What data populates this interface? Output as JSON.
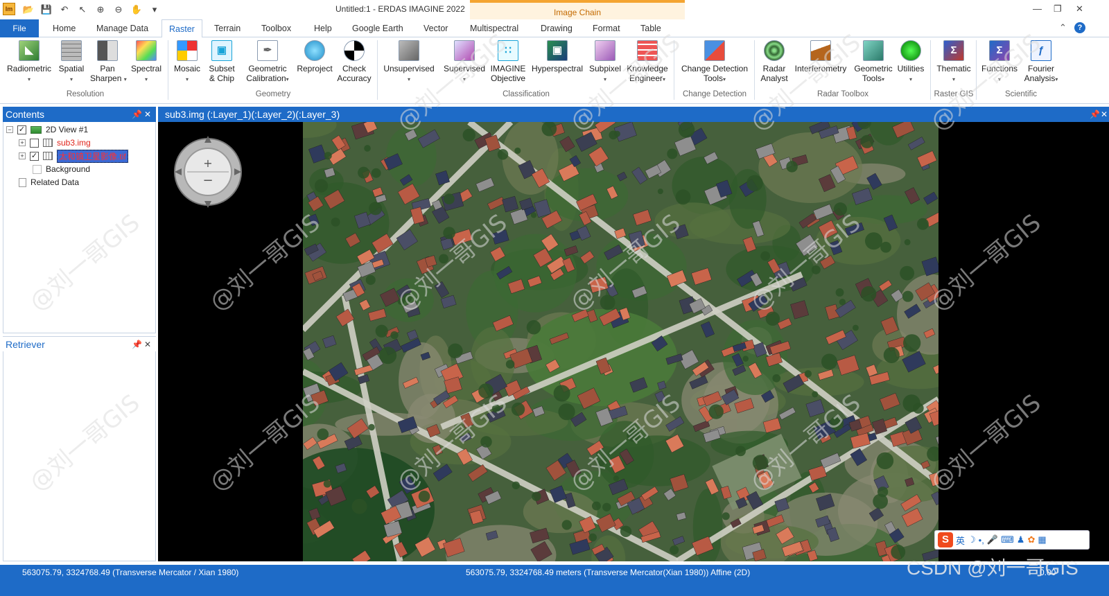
{
  "window": {
    "title": "Untitled:1 - ERDAS IMAGINE 2022",
    "contextual_tab": "Image Chain",
    "app_icon": "Im"
  },
  "quick_access": [
    "app-icon",
    "open-icon",
    "save-icon",
    "undo-icon",
    "select-icon",
    "zoom-in-icon",
    "zoom-out-icon",
    "pan-icon",
    "customize-icon"
  ],
  "tabs": {
    "file": "File",
    "items": [
      "Home",
      "Manage Data",
      "Raster",
      "Terrain",
      "Toolbox",
      "Help",
      "Google Earth",
      "Vector",
      "Multispectral",
      "Drawing",
      "Format",
      "Table"
    ],
    "active": "Raster"
  },
  "ribbon": {
    "groups": [
      {
        "label": "Resolution",
        "buttons": [
          "Radiometric",
          "Spatial",
          "Pan\nSharpen",
          "Spectral"
        ]
      },
      {
        "label": "Geometry",
        "buttons": [
          "Mosaic",
          "Subset\n& Chip",
          "Geometric\nCalibration",
          "Reproject",
          "Check\nAccuracy"
        ]
      },
      {
        "label": "Classification",
        "buttons": [
          "Unsupervised",
          "Supervised",
          "IMAGINE\nObjective",
          "Hyperspectral",
          "Subpixel",
          "Knowledge\nEngineer"
        ]
      },
      {
        "label": "Change Detection",
        "buttons": [
          "Change Detection\nTools"
        ]
      },
      {
        "label": "Radar Toolbox",
        "buttons": [
          "Radar\nAnalyst",
          "Interferometry",
          "Geometric\nTools",
          "Utilities"
        ]
      },
      {
        "label": "Raster GIS",
        "buttons": [
          "Thematic"
        ]
      },
      {
        "label": "Scientific",
        "buttons": [
          "Functions",
          "Fourier\nAnalysis"
        ]
      }
    ],
    "labels": {
      "radiometric": "Radiometric",
      "spatial": "Spatial",
      "pan1": "Pan",
      "pan2": "Sharpen",
      "spectral": "Spectral",
      "mosaic": "Mosaic",
      "subset1": "Subset",
      "subset2": "& Chip",
      "geo1": "Geometric",
      "geo2": "Calibration",
      "reproject": "Reproject",
      "check1": "Check",
      "check2": "Accuracy",
      "unsupervised": "Unsupervised",
      "supervised": "Supervised",
      "obj1": "IMAGINE",
      "obj2": "Objective",
      "hyperspectral": "Hyperspectral",
      "subpixel": "Subpixel",
      "ke1": "Knowledge",
      "ke2": "Engineer",
      "cd1": "Change Detection",
      "cd2": "Tools",
      "ra1": "Radar",
      "ra2": "Analyst",
      "interferometry": "Interferometry",
      "gt1": "Geometric",
      "gt2": "Tools",
      "utilities": "Utilities",
      "thematic": "Thematic",
      "functions": "Functions",
      "fa1": "Fourier",
      "fa2": "Analysis",
      "g_resolution": "Resolution",
      "g_geometry": "Geometry",
      "g_classification": "Classification",
      "g_change": "Change Detection",
      "g_radar": "Radar Toolbox",
      "g_rastergis": "Raster GIS",
      "g_scientific": "Scientific"
    }
  },
  "contents": {
    "title": "Contents",
    "view": "2D View #1",
    "layers": [
      {
        "name": "sub3.img",
        "checked": false
      },
      {
        "name": "太和镇卫星影像.tif",
        "checked": true
      }
    ],
    "background": "Background",
    "related": "Related Data"
  },
  "retriever": {
    "title": "Retriever"
  },
  "viewer": {
    "title": "sub3.img (:Layer_1)(:Layer_2)(:Layer_3)"
  },
  "status": {
    "left": "563075.79, 3324768.49   (Transverse Mercator / Xian 1980)",
    "mid": "563075.79, 3324768.49 meters (Transverse Mercator(Xian 1980))   Affine (2D)",
    "right": "0.00"
  },
  "ime": {
    "logo": "S",
    "lang": "英"
  },
  "watermark": {
    "text": "@刘一哥GIS",
    "csdn": "CSDN @刘一哥GIS"
  },
  "colors": {
    "accent": "#1e6bc7",
    "image_chain": "#f4a431"
  }
}
